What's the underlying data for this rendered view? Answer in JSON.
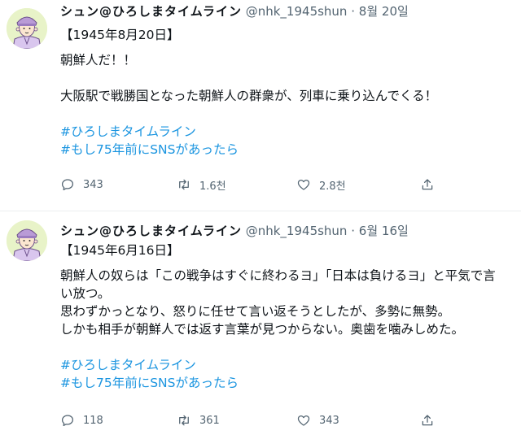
{
  "tweets": [
    {
      "name": "シュン@ひろしまタイムライン",
      "handle": "@nhk_1945shun",
      "separator": "·",
      "date": "8월 20일",
      "lines": [
        "【1945年8月20日】",
        "",
        "朝鮮人だ！！",
        "",
        "大阪駅で戦勝国となった朝鮮人の群衆が、列車に乗り込んでくる！",
        ""
      ],
      "hashtags": [
        "#ひろしまタイムライン",
        "#もし75年前にSNSがあったら"
      ],
      "reply_count": "343",
      "retweet_count": "1.6천",
      "like_count": "2.8천"
    },
    {
      "name": "シュン@ひろしまタイムライン",
      "handle": "@nhk_1945shun",
      "separator": "·",
      "date": "6월 16일",
      "lines": [
        "【1945年6月16日】",
        "",
        "朝鮮人の奴らは「この戦争はすぐに終わるヨ」「日本は負けるヨ」と平気で言",
        "い放つ。",
        "思わずかっとなり、怒りに任せて言い返そうとしたが、多勢に無勢。",
        "しかも相手が朝鮮人では返す言葉が見つからない。奥歯を噛みしめた。",
        ""
      ],
      "hashtags": [
        "#ひろしまタイムライン",
        "#もし75年前にSNSがあったら"
      ],
      "reply_count": "118",
      "retweet_count": "361",
      "like_count": "343"
    }
  ],
  "icons": {
    "reply": "reply-icon",
    "retweet": "retweet-icon",
    "like": "heart-icon",
    "share": "share-icon"
  },
  "colors": {
    "hashtag": "#1b95e0",
    "muted": "#536471",
    "avatar_bg": "#e8f3c8",
    "avatar_cap": "#b99bd6"
  }
}
